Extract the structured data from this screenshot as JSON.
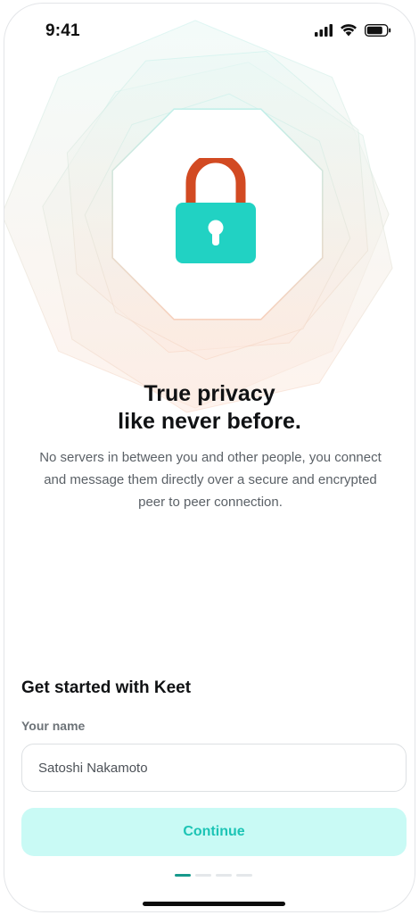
{
  "status_bar": {
    "time": "9:41",
    "icons": [
      "signal-icon",
      "wifi-icon",
      "battery-icon"
    ]
  },
  "hero": {
    "icon": "padlock-icon",
    "colors": {
      "shackle": "#d24a22",
      "body": "#21d2c3",
      "keyhole": "#ffffff",
      "ring_teal": "#bdeee8",
      "ring_peach": "#f6cdb8"
    }
  },
  "onboarding": {
    "headline_line1": "True privacy",
    "headline_line2": "like never before.",
    "description": "No servers in between you and other people, you connect and message them directly over a secure and encrypted peer to peer connection."
  },
  "form": {
    "section_title": "Get started with Keet",
    "name_label": "Your name",
    "name_value": "Satoshi Nakamoto",
    "name_placeholder": "",
    "continue_label": "Continue"
  },
  "page_indicator": {
    "current_page": 1,
    "total_pages": 4
  },
  "colors": {
    "accent": "#1cc4b5",
    "button_bg": "#c9faf5",
    "text_primary": "#101214",
    "text_secondary": "#5b6167"
  }
}
